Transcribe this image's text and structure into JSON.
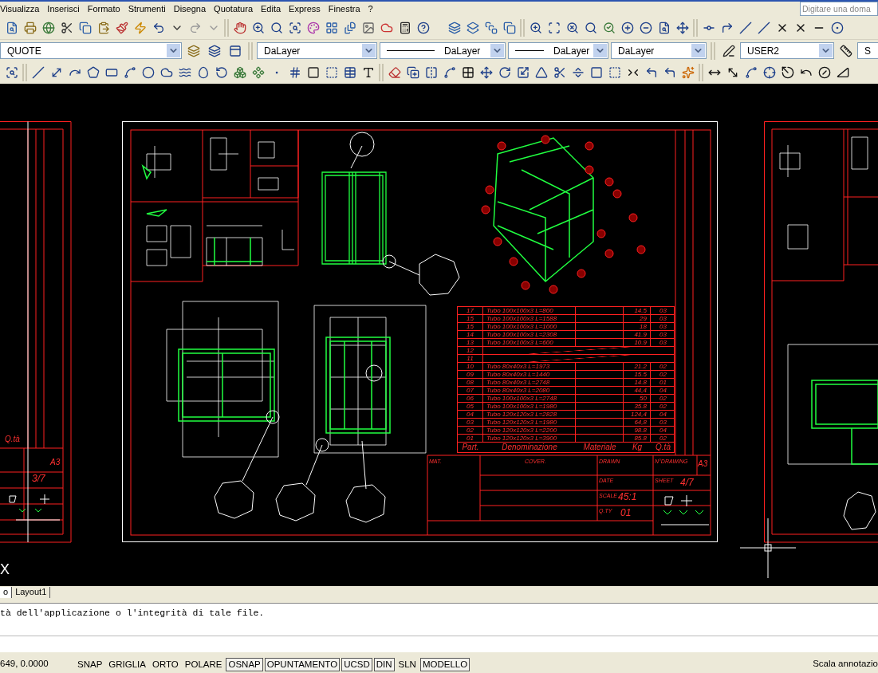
{
  "menu": [
    "Visualizza",
    "Inserisci",
    "Formato",
    "Strumenti",
    "Disegna",
    "Quotatura",
    "Edita",
    "Express",
    "Finestra",
    "?"
  ],
  "help_search": {
    "placeholder": "Digitare una doma"
  },
  "properties": {
    "layer": "QUOTE",
    "color_setting": "DaLayer",
    "linetype": "DaLayer",
    "lineweight": "DaLayer",
    "plot_style": "DaLayer",
    "text_style": "USER2",
    "dim_style": "S"
  },
  "left_sheet": {
    "qty_header": "Q.tà",
    "format": "A3",
    "sheet": "3/7"
  },
  "sheet": {
    "headers": [
      "Part.",
      "Denominazione",
      "Materiale",
      "Kg",
      "Q.tà"
    ],
    "parts": [
      {
        "kind": "item",
        "part": "17",
        "name": "Tubo 100x100x3 L=800",
        "kg": "14.5",
        "qty": "03"
      },
      {
        "kind": "item",
        "part": "15",
        "name": "Tubo 100x100x3 L=1588",
        "kg": "29",
        "qty": "03"
      },
      {
        "kind": "item",
        "part": "15",
        "name": "Tubo 100x100x3 L=1000",
        "kg": "18",
        "qty": "03"
      },
      {
        "kind": "item",
        "part": "14",
        "name": "Tubo 100x100x3 L=2308",
        "kg": "41.9",
        "qty": "03"
      },
      {
        "kind": "item",
        "part": "13",
        "name": "Tubo 100x100x3 L=600",
        "kg": "10.9",
        "qty": "03"
      },
      {
        "kind": "struck",
        "part": "12"
      },
      {
        "kind": "struck",
        "part": "11"
      },
      {
        "kind": "item",
        "part": "10",
        "name": "Tubo 80x40x3 L=1973",
        "kg": "21.2",
        "qty": "02"
      },
      {
        "kind": "item",
        "part": "09",
        "name": "Tubo 80x40x3 L=1440",
        "kg": "15.5",
        "qty": "02"
      },
      {
        "kind": "item",
        "part": "08",
        "name": "Tubo 80x40x3 L=2748",
        "kg": "14.8",
        "qty": "01"
      },
      {
        "kind": "item",
        "part": "07",
        "name": "Tubo 80x40x3 L=2080",
        "kg": "44,4",
        "qty": "04"
      },
      {
        "kind": "item",
        "part": "06",
        "name": "Tubo 100x100x3 L=2748",
        "kg": "50",
        "qty": "02"
      },
      {
        "kind": "item",
        "part": "05",
        "name": "Tubo 100x100x3 L=1980",
        "kg": "35.8",
        "qty": "02"
      },
      {
        "kind": "item",
        "part": "04",
        "name": "Tubo 120x120x3 L=2828",
        "kg": "124,4",
        "qty": "04"
      },
      {
        "kind": "item",
        "part": "03",
        "name": "Tubo 120x120x3 L=1980",
        "kg": "64,8",
        "qty": "03"
      },
      {
        "kind": "item",
        "part": "02",
        "name": "Tubo 120x120x3 L=2200",
        "kg": "98.8",
        "qty": "04"
      },
      {
        "kind": "item",
        "part": "01",
        "name": "Tubo 120x120x3 L=3900",
        "kg": "85.8",
        "qty": "02"
      }
    ],
    "title_block": {
      "mat_label": "MAT.",
      "cover_label": "COVER.",
      "drawn_label": "DRAWN",
      "drawing_no_label": "N°DRAWING",
      "format": "A3",
      "date_label": "DATE",
      "sheet_label": "SHEET",
      "sheet": "4/7",
      "scale_label": "SCALE",
      "scale": "45:1",
      "qty_label": "Q.TY",
      "qty": "01"
    }
  },
  "ucs_label": "X",
  "layout_tabs": [
    {
      "label": "o",
      "selected": true
    },
    {
      "label": "Layout1",
      "selected": false
    }
  ],
  "command_line": "tà dell'applicazione o l'integrità di tale file.",
  "status_bar": {
    "coordinates": "649, 0.0000",
    "toggles": [
      {
        "label": "SNAP",
        "on": false
      },
      {
        "label": "GRIGLIA",
        "on": false
      },
      {
        "label": "ORTO",
        "on": false
      },
      {
        "label": "POLARE",
        "on": false
      },
      {
        "label": "OSNAP",
        "on": true
      },
      {
        "label": "OPUNTAMENTO",
        "on": true
      },
      {
        "label": "UCSD",
        "on": true
      },
      {
        "label": "DIN",
        "on": true
      },
      {
        "label": "SLN",
        "on": false
      },
      {
        "label": "MODELLO",
        "on": true
      }
    ],
    "annotation_scale": "Scala annotazio"
  }
}
